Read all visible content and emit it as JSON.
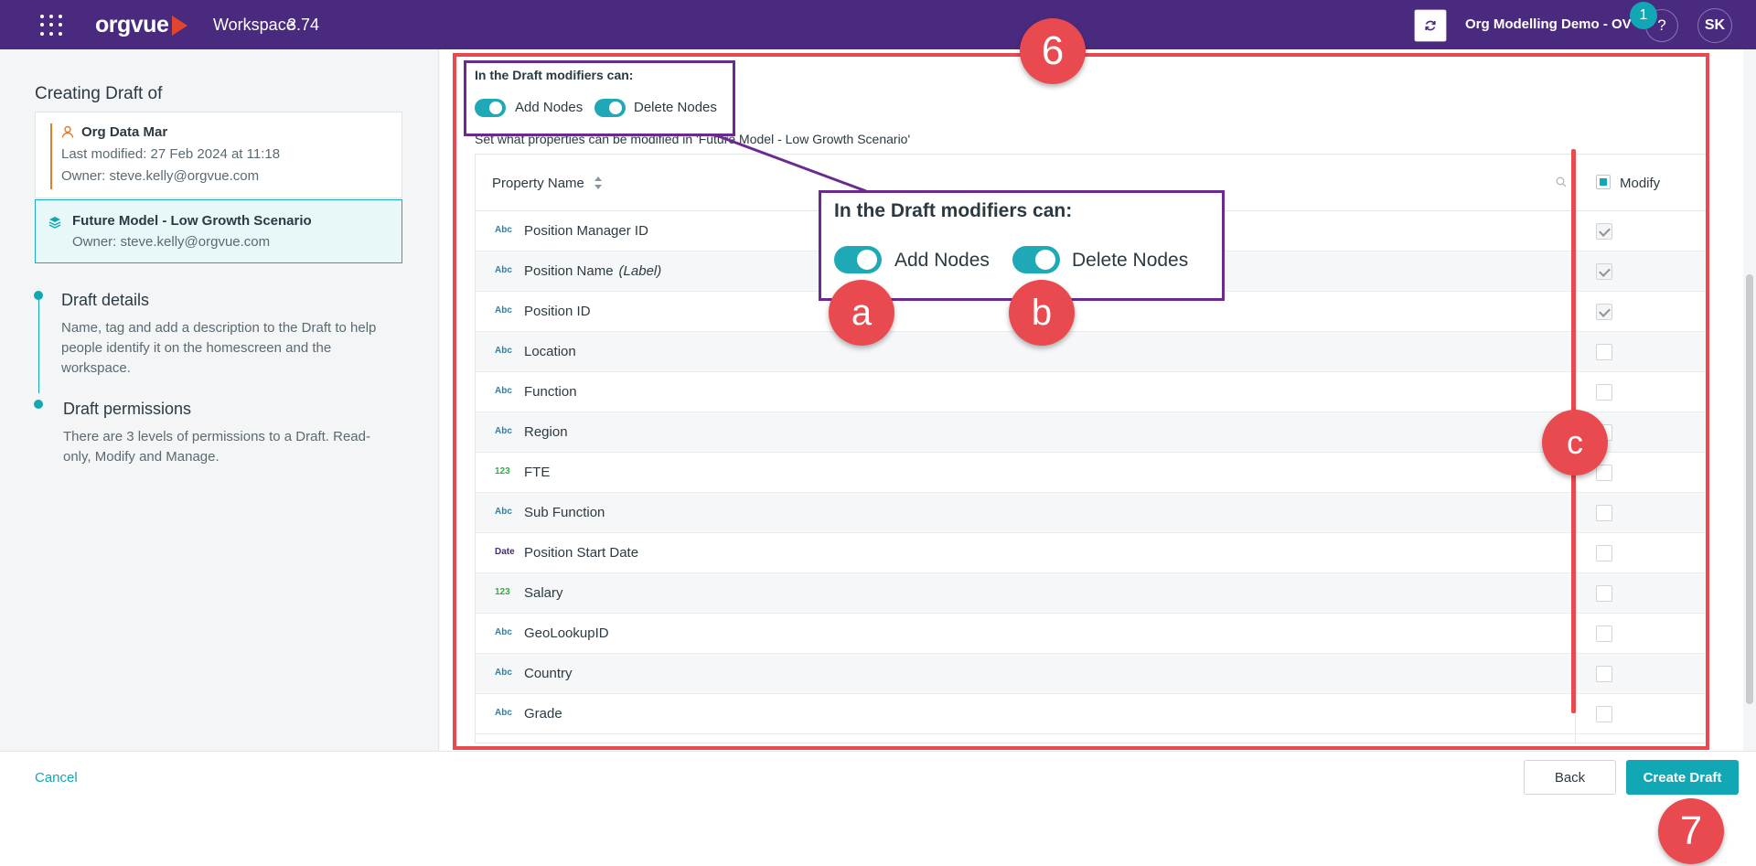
{
  "header": {
    "logo_text": "orgvue",
    "workspace_label": "Workspace",
    "version": "3.74",
    "org_name": "Org Modelling Demo - OV",
    "notification_count": "1",
    "help_label": "?",
    "avatar_initials": "SK",
    "brand_color": "#4a2a7f",
    "accent_color": "#11a7b4"
  },
  "left": {
    "title": "Creating Draft of",
    "source": {
      "name": "Org Data Mar",
      "modified": "Last modified: 27 Feb 2024 at 11:18",
      "owner": "Owner: steve.kelly@orgvue.com"
    },
    "draft": {
      "name": "Future Model - Low Growth Scenario",
      "owner": "Owner: steve.kelly@orgvue.com"
    },
    "steps": [
      {
        "title": "Draft details",
        "desc": "Name, tag and add a description to the Draft to help people identify it on the homescreen and the workspace."
      },
      {
        "title": "Draft permissions",
        "desc": "There are 3 levels of permissions to a Draft. Read-only, Modify and Manage."
      }
    ]
  },
  "main": {
    "modifiers_label": "In the Draft modifiers can:",
    "add_nodes": "Add Nodes",
    "delete_nodes": "Delete Nodes",
    "set_what": "Set what properties can be modified in 'Future Model - Low Growth Scenario'",
    "columns": {
      "name": "Property Name",
      "modify": "Modify"
    },
    "rows": [
      {
        "type": "Abc",
        "name": "Position Manager ID",
        "suffix": "",
        "checked": true
      },
      {
        "type": "Abc",
        "name": "Position Name",
        "suffix": "(Label)",
        "checked": true
      },
      {
        "type": "Abc",
        "name": "Position ID",
        "suffix": "",
        "checked": true
      },
      {
        "type": "Abc",
        "name": "Location",
        "suffix": "",
        "checked": false
      },
      {
        "type": "Abc",
        "name": "Function",
        "suffix": "",
        "checked": false
      },
      {
        "type": "Abc",
        "name": "Region",
        "suffix": "",
        "checked": false
      },
      {
        "type": "123",
        "name": "FTE",
        "suffix": "",
        "checked": false
      },
      {
        "type": "Abc",
        "name": "Sub Function",
        "suffix": "",
        "checked": false
      },
      {
        "type": "Date",
        "name": "Position Start Date",
        "suffix": "",
        "checked": false
      },
      {
        "type": "123",
        "name": "Salary",
        "suffix": "",
        "checked": false
      },
      {
        "type": "Abc",
        "name": "GeoLookupID",
        "suffix": "",
        "checked": false
      },
      {
        "type": "Abc",
        "name": "Country",
        "suffix": "",
        "checked": false
      },
      {
        "type": "Abc",
        "name": "Grade",
        "suffix": "",
        "checked": false
      }
    ]
  },
  "annotations": {
    "step6": "6",
    "step7": "7",
    "a": "a",
    "b": "b",
    "c": "c",
    "annotation_color": "#e84a4f",
    "callout_color": "#6a2a8f"
  },
  "footer": {
    "cancel": "Cancel",
    "back": "Back",
    "create": "Create Draft"
  }
}
